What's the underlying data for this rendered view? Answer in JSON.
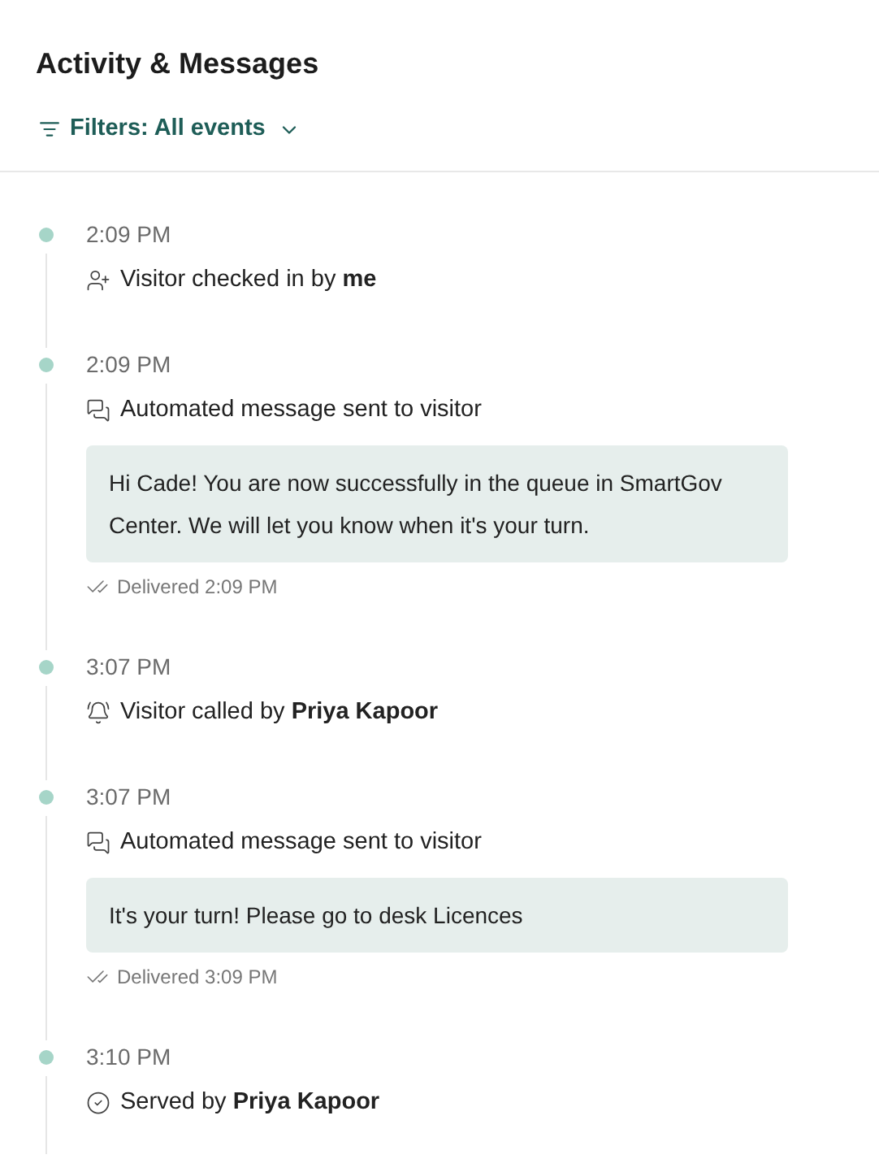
{
  "title": "Activity & Messages",
  "filter": {
    "label": "Filters: All events"
  },
  "events": [
    {
      "kind": "checkin",
      "time": "2:09 PM",
      "text": "Visitor checked in by **me**"
    },
    {
      "kind": "message",
      "time": "2:09 PM",
      "text": "Automated message sent to visitor",
      "message": "Hi Cade! You are now successfully in the queue in SmartGov Center. We will let you know when it's your turn.",
      "delivered": "Delivered 2:09 PM"
    },
    {
      "kind": "called",
      "time": "3:07 PM",
      "text": "Visitor called by **Priya Kapoor**"
    },
    {
      "kind": "message",
      "time": "3:07 PM",
      "text": "Automated message sent to visitor",
      "message": "It's your turn! Please go to desk Licences",
      "delivered": "Delivered 3:09 PM"
    },
    {
      "kind": "served",
      "time": "3:10 PM",
      "text": "Served by **Priya Kapoor**"
    }
  ]
}
